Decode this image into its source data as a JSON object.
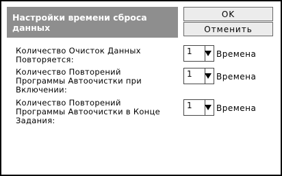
{
  "header": {
    "title": "Настройки времени сброса данных"
  },
  "buttons": {
    "ok_label": "OK",
    "cancel_label": "Отменить"
  },
  "settings": [
    {
      "label": "Количество Очисток Данных Повторяется:",
      "value": "1",
      "unit": "Времена"
    },
    {
      "label": "Количество Повторений Программы Автоочистки при Включении:",
      "value": "1",
      "unit": "Времена"
    },
    {
      "label": "Количество Повторений Программы Автоочистки в Конце Задания:",
      "value": "1",
      "unit": "Времена"
    }
  ]
}
